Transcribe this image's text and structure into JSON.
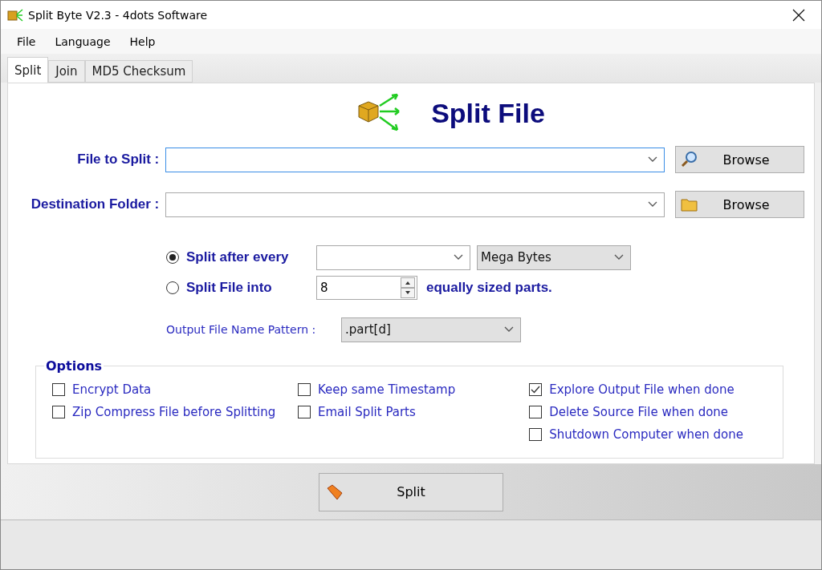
{
  "window": {
    "title": "Split Byte V2.3 - 4dots Software"
  },
  "menu": [
    "File",
    "Language",
    "Help"
  ],
  "tabs": [
    {
      "label": "Split",
      "selected": true
    },
    {
      "label": "Join",
      "selected": false
    },
    {
      "label": "MD5 Checksum",
      "selected": false
    }
  ],
  "heading": "Split File",
  "file_to_split": {
    "label": "File to Split :",
    "button": "Browse"
  },
  "destination_folder": {
    "label": "Destination Folder :",
    "button": "Browse"
  },
  "split_modes": [
    {
      "label": "Split after every",
      "selected": true,
      "kind": "size",
      "unit": "Mega Bytes"
    },
    {
      "label": "Split File into",
      "selected": false,
      "kind": "parts",
      "value": "8",
      "suffix": "equally sized parts."
    }
  ],
  "output_pattern": {
    "label": "Output File Name Pattern :",
    "value": ".part[d]"
  },
  "options": {
    "title": "Options",
    "columns": [
      [
        {
          "label": "Encrypt Data",
          "checked": false
        },
        {
          "label": "Zip Compress File before Splitting",
          "checked": false
        }
      ],
      [
        {
          "label": "Keep same Timestamp",
          "checked": false
        },
        {
          "label": "Email Split Parts",
          "checked": false
        }
      ],
      [
        {
          "label": "Explore Output File when done",
          "checked": true
        },
        {
          "label": "Delete Source File when done",
          "checked": false
        },
        {
          "label": "Shutdown Computer when done",
          "checked": false
        }
      ]
    ]
  },
  "split_button": "Split"
}
